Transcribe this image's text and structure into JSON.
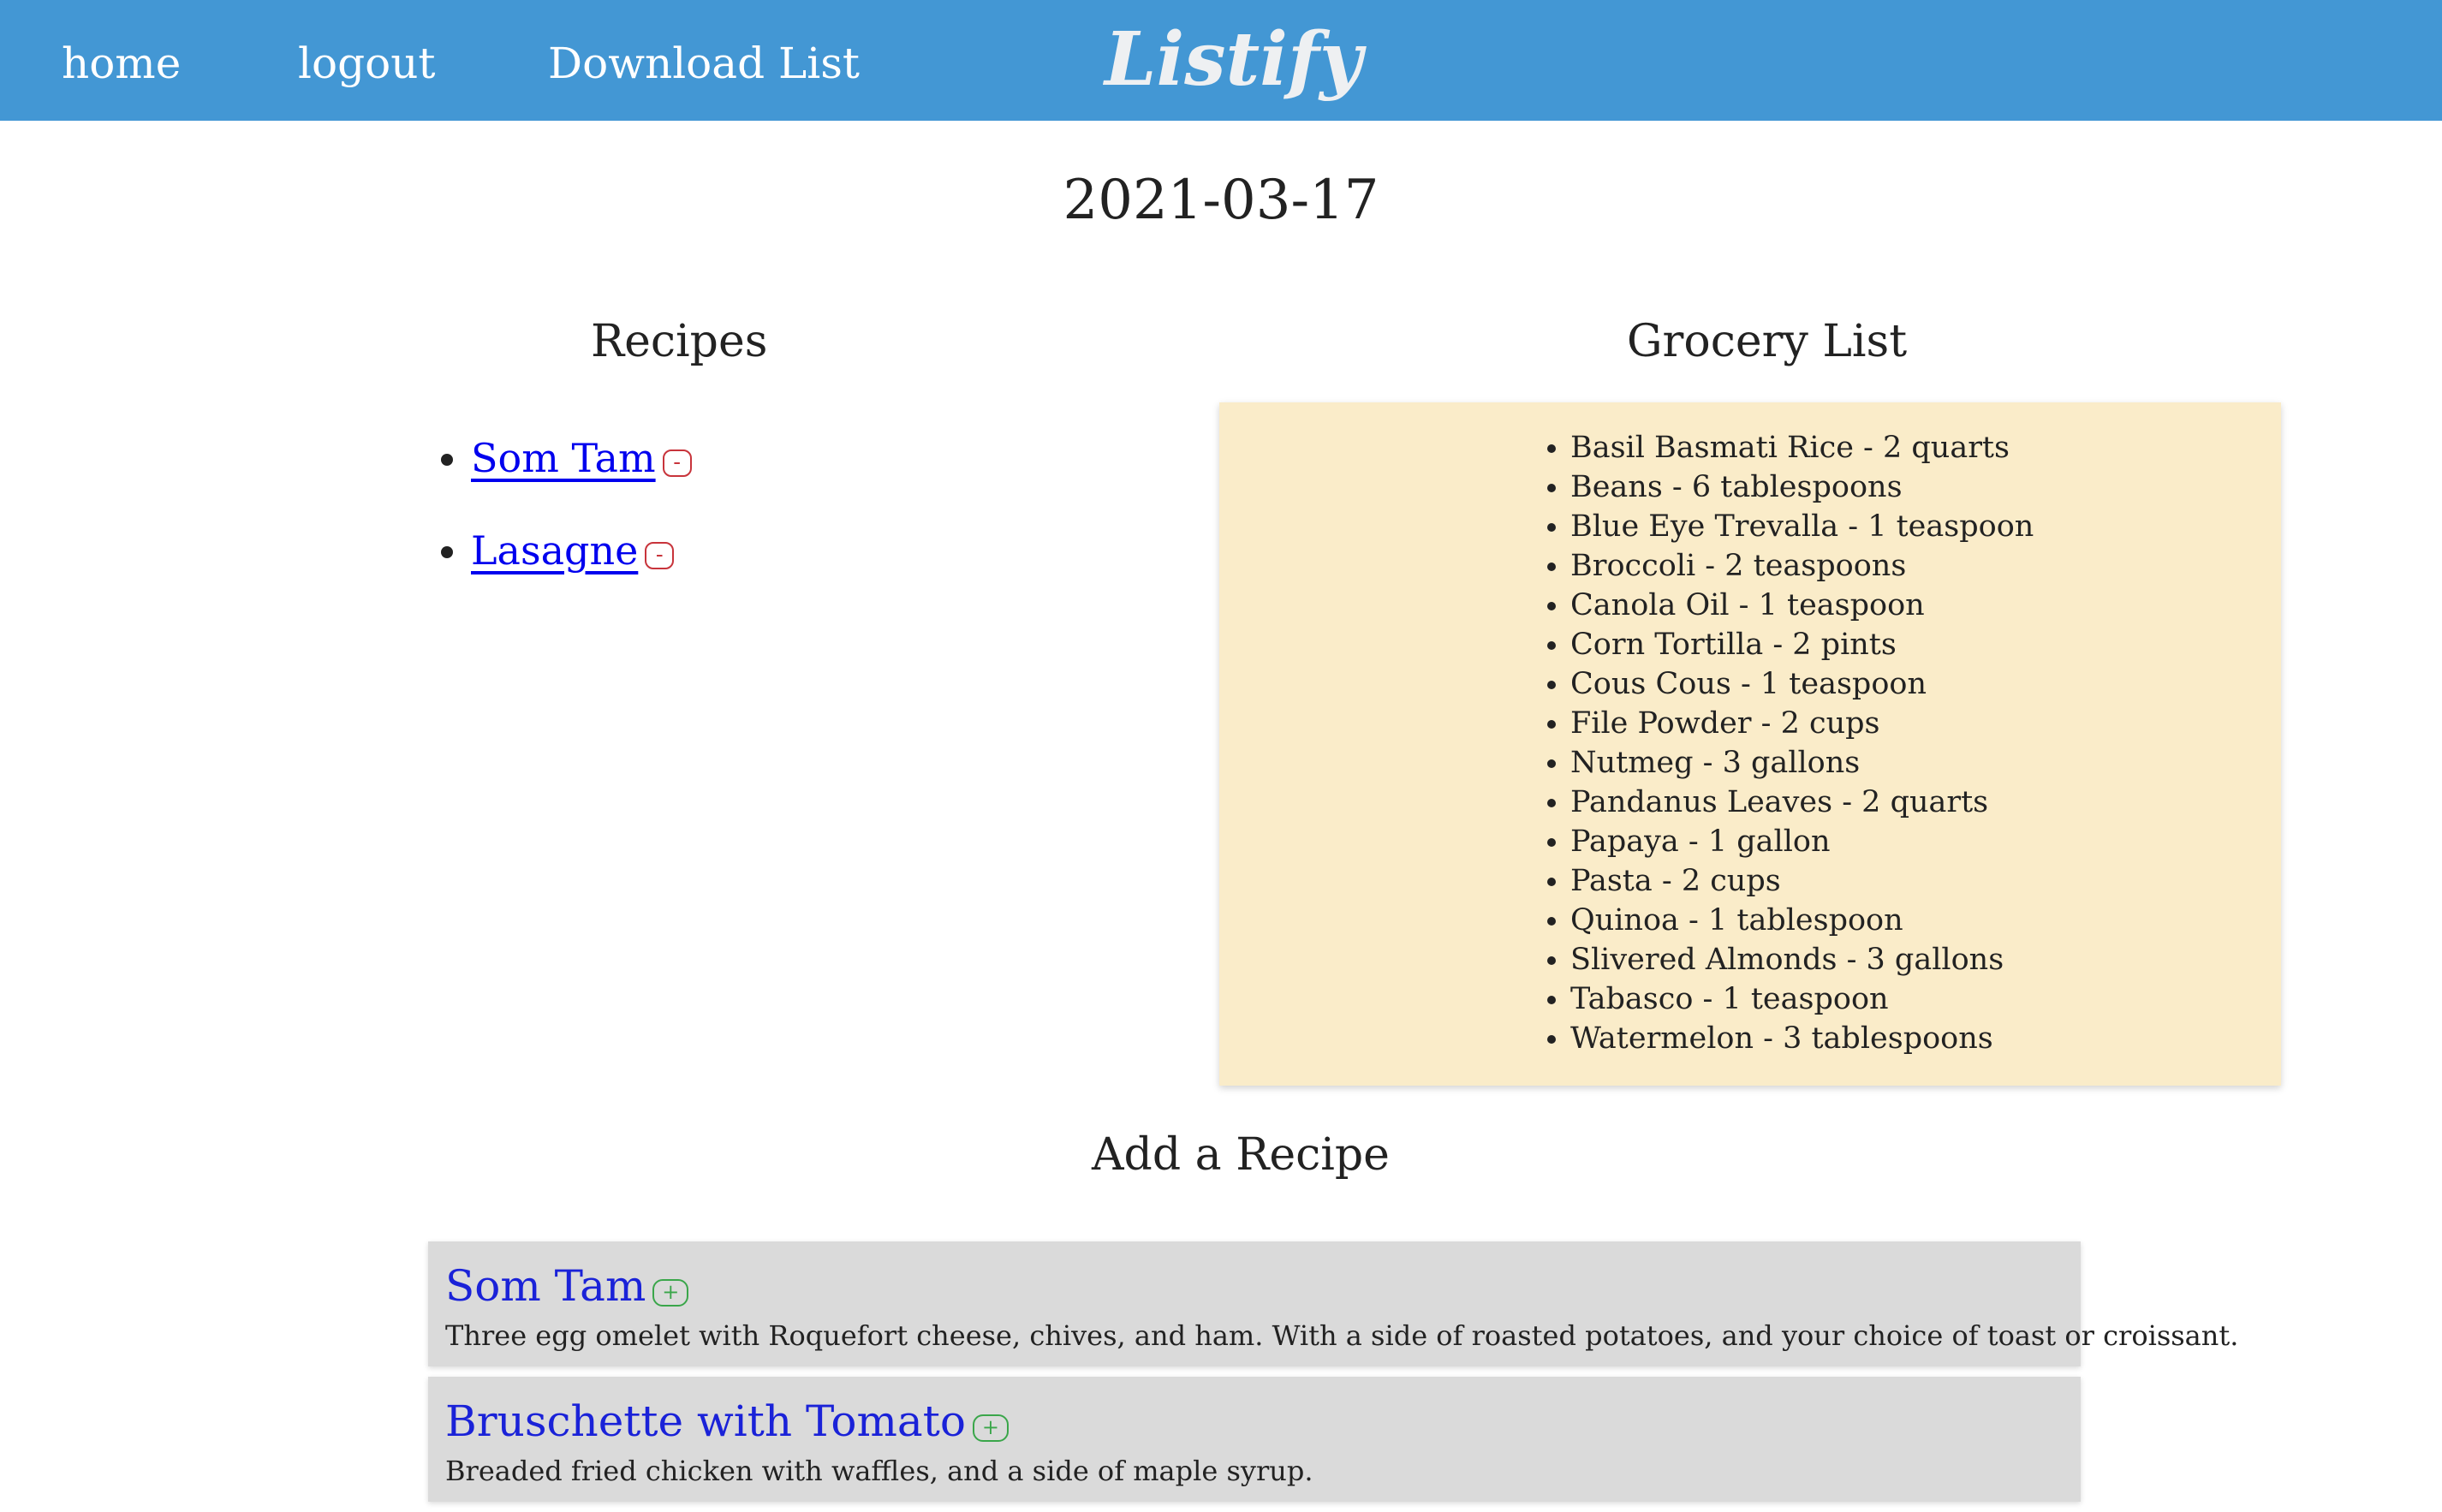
{
  "colors": {
    "navbar": "#4397d4",
    "nav_text": "#ffffff",
    "link": "#0000ee",
    "remove": "#c8343b",
    "add": "#3aa64a",
    "grocery_panel": "#faecc9",
    "card_bg": "#dadada"
  },
  "nav": {
    "home": "home",
    "logout": "logout",
    "download": "Download List",
    "brand": "Listify"
  },
  "page": {
    "date": "2021-03-17"
  },
  "recipes": {
    "heading": "Recipes",
    "items": [
      {
        "name": "Som Tam",
        "remove_icon": "minus-icon",
        "remove_label": "-"
      },
      {
        "name": "Lasagne",
        "remove_icon": "minus-icon",
        "remove_label": "-"
      }
    ]
  },
  "grocery": {
    "heading": "Grocery List",
    "items": [
      "Basil Basmati Rice - 2 quarts",
      "Beans - 6 tablespoons",
      "Blue Eye Trevalla - 1 teaspoon",
      "Broccoli - 2 teaspoons",
      "Canola Oil - 1 teaspoon",
      "Corn Tortilla - 2 pints",
      "Cous Cous - 1 teaspoon",
      "File Powder - 2 cups",
      "Nutmeg - 3 gallons",
      "Pandanus Leaves - 2 quarts",
      "Papaya - 1 gallon",
      "Pasta - 2 cups",
      "Quinoa - 1 tablespoon",
      "Slivered Almonds - 3 gallons",
      "Tabasco - 1 teaspoon",
      "Watermelon - 3 tablespoons"
    ]
  },
  "add_recipe": {
    "heading": "Add a Recipe",
    "cards": [
      {
        "title": "Som Tam",
        "add_icon": "plus-icon",
        "add_label": "+",
        "description": "Three egg omelet with Roquefort cheese, chives, and ham. With a side of roasted potatoes, and your choice of toast or croissant."
      },
      {
        "title": "Bruschette with Tomato",
        "add_icon": "plus-icon",
        "add_label": "+",
        "description": "Breaded fried chicken with waffles, and a side of maple syrup."
      }
    ]
  }
}
